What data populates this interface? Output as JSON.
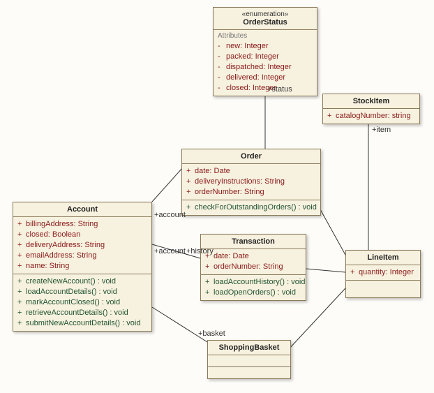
{
  "enum": {
    "stereotype": "«enumeration»",
    "name": "OrderStatus",
    "attrTitle": "Attributes",
    "items": [
      {
        "name": "new: Integer"
      },
      {
        "name": "packed: Integer"
      },
      {
        "name": "dispatched: Integer"
      },
      {
        "name": "delivered: Integer"
      },
      {
        "name": "closed: Integer"
      }
    ]
  },
  "stockItem": {
    "name": "StockItem",
    "attrs": [
      {
        "vis": "+",
        "text": "catalogNumber: string"
      }
    ]
  },
  "order": {
    "name": "Order",
    "attrs": [
      {
        "vis": "+",
        "text": "date: Date"
      },
      {
        "vis": "+",
        "text": "deliveryInstructions: String"
      },
      {
        "vis": "+",
        "text": "orderNumber: String"
      }
    ],
    "ops": [
      {
        "vis": "+",
        "text": "checkForOutstandingOrders() : void"
      }
    ]
  },
  "account": {
    "name": "Account",
    "attrs": [
      {
        "vis": "+",
        "text": "billingAddress: String"
      },
      {
        "vis": "+",
        "text": "closed: Boolean"
      },
      {
        "vis": "+",
        "text": "deliveryAddress: String"
      },
      {
        "vis": "+",
        "text": "emailAddress: String"
      },
      {
        "vis": "+",
        "text": "name: String"
      }
    ],
    "ops": [
      {
        "vis": "+",
        "text": "createNewAccount() : void"
      },
      {
        "vis": "+",
        "text": "loadAccountDetails() : void"
      },
      {
        "vis": "+",
        "text": "markAccountClosed() : void"
      },
      {
        "vis": "+",
        "text": "retrieveAccountDetails() : void"
      },
      {
        "vis": "+",
        "text": "submitNewAccountDetails() : void"
      }
    ]
  },
  "transaction": {
    "name": "Transaction",
    "attrs": [
      {
        "vis": "+",
        "text": "date: Date"
      },
      {
        "vis": "+",
        "text": "orderNumber: String"
      }
    ],
    "ops": [
      {
        "vis": "+",
        "text": "loadAccountHistory() : void"
      },
      {
        "vis": "+",
        "text": "loadOpenOrders() : void"
      }
    ]
  },
  "lineItem": {
    "name": "LineItem",
    "attrs": [
      {
        "vis": "+",
        "text": "quantity: Integer"
      }
    ]
  },
  "shoppingBasket": {
    "name": "ShoppingBasket"
  },
  "labels": {
    "status": "+status",
    "item": "+item",
    "account1": "+account",
    "account2": "+account",
    "history": "+history",
    "basket": "+basket"
  }
}
